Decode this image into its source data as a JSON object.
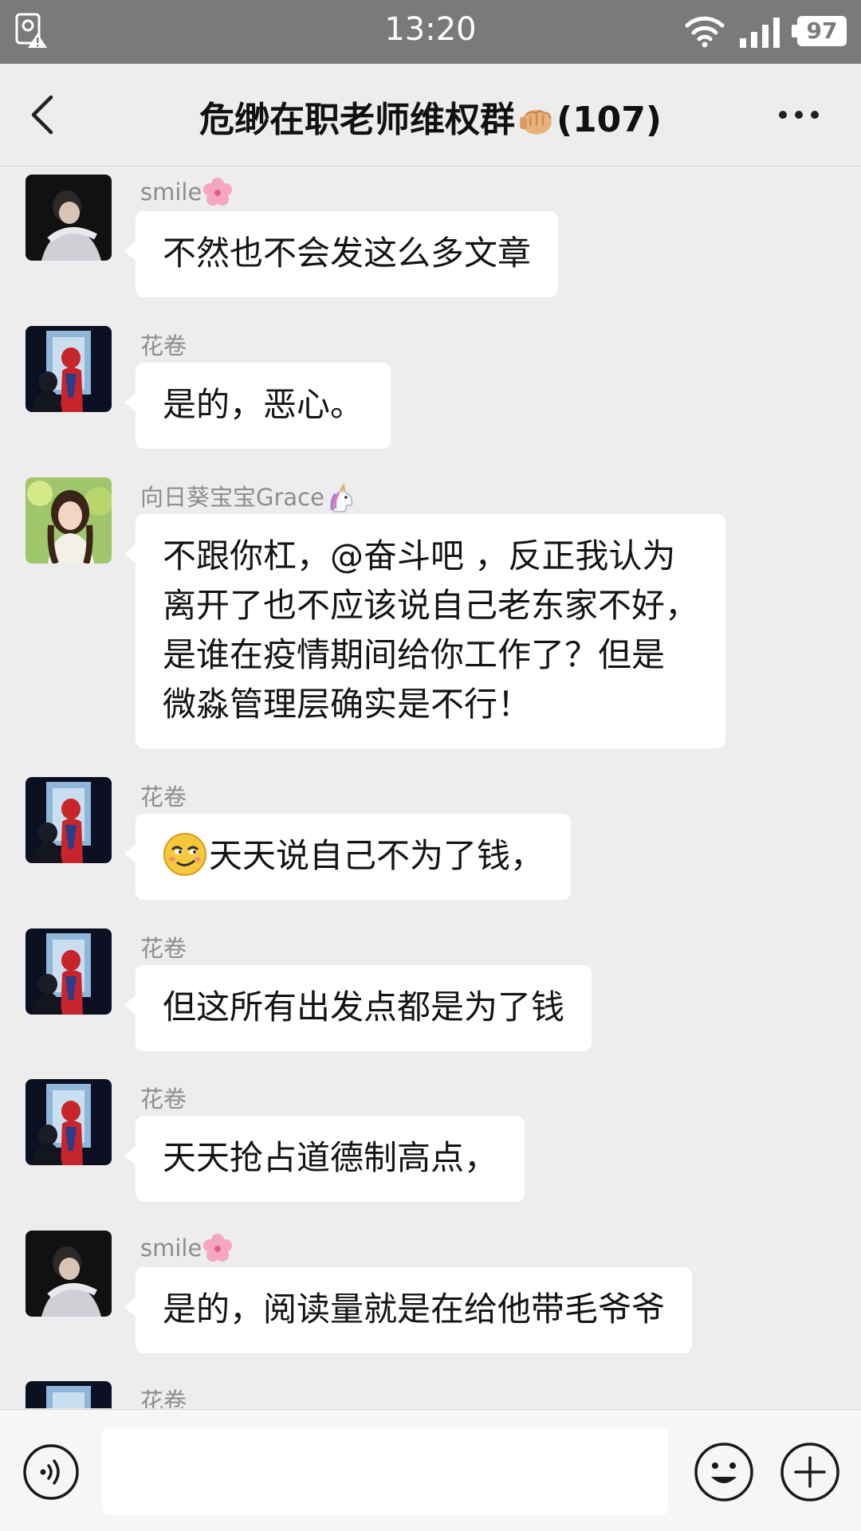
{
  "status_bar": {
    "time": "13:20",
    "battery": "97",
    "icons": [
      "alert-icon",
      "wifi-icon",
      "signal-icon",
      "battery-icon"
    ]
  },
  "header": {
    "title": "危缈在职老师维权群",
    "member_count": "(107)",
    "icons": [
      "back-icon",
      "fist-emoji",
      "more-icon"
    ]
  },
  "messages": [
    {
      "sender": "smile",
      "sender_emoji": "cherry-blossom-emoji",
      "text": "不然也不会发这么多文章"
    },
    {
      "sender": "花卷",
      "text": "是的，恶心。"
    },
    {
      "sender": "向日葵宝宝Grace",
      "sender_emoji": "unicorn-emoji",
      "lines": [
        "不跟你杠，@奋斗吧 ，反正我认为",
        "离开了也不应该说自己老东家不好，",
        "是谁在疫情期间给你工作了？但是",
        "微淼管理层确实是不行！"
      ]
    },
    {
      "sender": "花卷",
      "lead_emoji": "smirk-emoji",
      "text": "天天说自己不为了钱，"
    },
    {
      "sender": "花卷",
      "text": "但这所有出发点都是为了钱"
    },
    {
      "sender": "花卷",
      "text": "天天抢占道德制高点，"
    },
    {
      "sender": "smile",
      "sender_emoji": "cherry-blossom-emoji",
      "text": "是的，阅读量就是在给他带毛爷爷"
    },
    {
      "sender": "花卷"
    }
  ],
  "input_bar": {
    "placeholder": "",
    "icons": [
      "voice-icon",
      "emoji-icon",
      "plus-icon"
    ]
  },
  "colors": {
    "status_bar_bg": "#7a7a7a",
    "chat_bg": "#ededed",
    "bubble_bg": "#ffffff",
    "sender_text": "#8d8d8d"
  }
}
